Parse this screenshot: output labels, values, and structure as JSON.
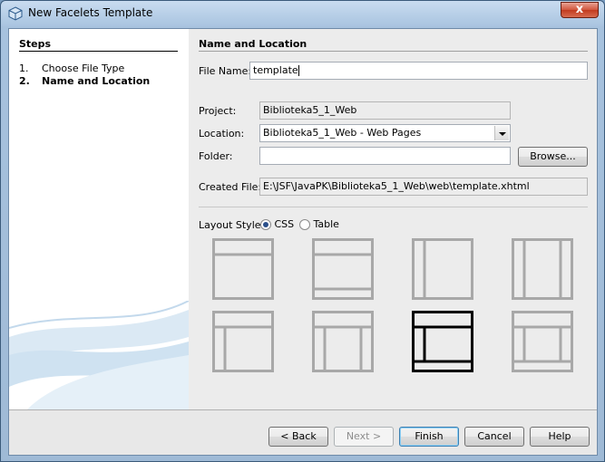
{
  "window": {
    "title": "New Facelets Template",
    "close_glyph": "x"
  },
  "steps": {
    "title": "Steps",
    "items": [
      {
        "num": "1.",
        "label": "Choose File Type",
        "current": false
      },
      {
        "num": "2.",
        "label": "Name and Location",
        "current": true
      }
    ]
  },
  "form": {
    "section_title": "Name and Location",
    "file_name_label": "File Name:",
    "file_name_value": "template",
    "project_label": "Project:",
    "project_value": "Biblioteka5_1_Web",
    "location_label": "Location:",
    "location_value": "Biblioteka5_1_Web - Web Pages",
    "folder_label": "Folder:",
    "folder_value": "",
    "browse_label": "Browse...",
    "created_file_label": "Created File:",
    "created_file_value": "E:\\JSF\\JavaPK\\Biblioteka5_1_Web\\web\\template.xhtml",
    "layout_style_label": "Layout Style:",
    "layout_options": [
      {
        "label": "CSS",
        "selected": true
      },
      {
        "label": "Table",
        "selected": false
      }
    ],
    "selected_layout_index": 6
  },
  "buttons": {
    "back": "< Back",
    "next": "Next >",
    "finish": "Finish",
    "cancel": "Cancel",
    "help": "Help"
  },
  "colors": {
    "selected_layout_stroke": "#000000",
    "layout_stroke": "#a8a8a8"
  }
}
